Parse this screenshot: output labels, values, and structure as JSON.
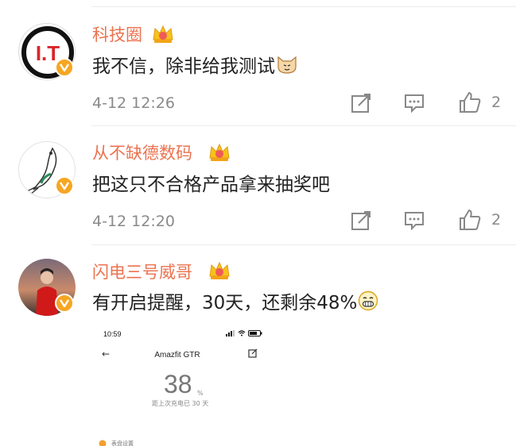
{
  "comments": [
    {
      "username": "科技圈",
      "text": "我不信，除非给我测试",
      "time": "4-12 12:26",
      "likes": "2",
      "avatar_text": "I.T"
    },
    {
      "username": "从不缺德数码",
      "text": "把这只不合格产品拿来抽奖吧",
      "time": "4-12 12:20",
      "likes": "2"
    },
    {
      "username": "闪电三号威哥",
      "text": "有开启提醒，30天，还剩余48%",
      "embedded_screenshot": {
        "status_time": "10:59",
        "title": "Amazfit GTR",
        "value": "38",
        "unit": "%",
        "subtitle": "距上次充电已 30 天",
        "footer": "表盘设置"
      }
    }
  ],
  "colors": {
    "username": "#eb7350",
    "text": "#222222",
    "meta": "#8a8a8a",
    "verified_badge": "#f6a623"
  },
  "icons": [
    "crown-badge-icon",
    "verified-v-icon",
    "cat-emoji-icon",
    "grin-emoji-icon",
    "repost-icon",
    "comment-icon",
    "like-icon"
  ]
}
